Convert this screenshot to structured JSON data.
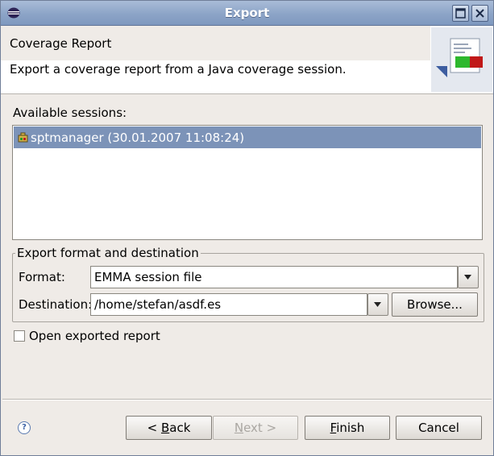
{
  "window": {
    "title": "Export"
  },
  "header": {
    "page_title": "Coverage Report",
    "description": "Export a coverage report from a Java coverage session."
  },
  "sessions": {
    "label": "Available sessions:",
    "items": [
      {
        "label": "sptmanager (30.01.2007 11:08:24)",
        "selected": true
      }
    ]
  },
  "export": {
    "group_label": "Export format and destination",
    "format_label": "Format:",
    "format_value": "EMMA session file",
    "destination_label": "Destination:",
    "destination_value": "/home/stefan/asdf.es",
    "browse_label": "Browse..."
  },
  "options": {
    "open_report_label": "Open exported report",
    "open_report_checked": false
  },
  "buttons": {
    "back_pre": "< ",
    "back_mnemonic": "B",
    "back_post": "ack",
    "next_mnemonic": "N",
    "next_post": "ext >",
    "finish_mnemonic": "F",
    "finish_post": "inish",
    "cancel": "Cancel"
  },
  "colors": {
    "titlebar": "#8ca4c7",
    "selection": "#7c93b8",
    "dialog_bg": "#efebe7"
  }
}
